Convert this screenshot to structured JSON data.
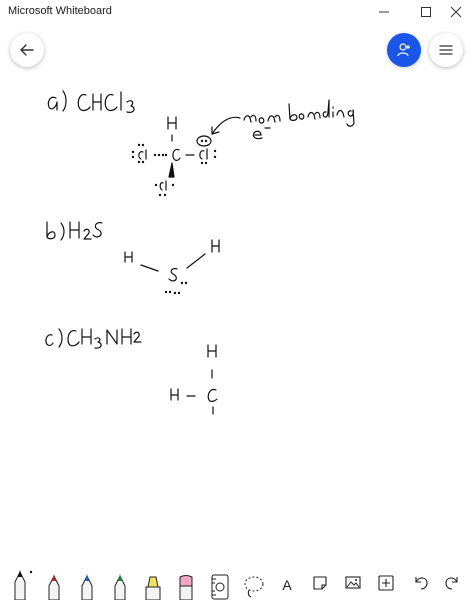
{
  "window": {
    "title": "Microsoft Whiteboard"
  },
  "window_controls": {
    "minimize_icon": "minimize-icon",
    "maximize_icon": "maximize-icon",
    "close_icon": "close-icon"
  },
  "header": {
    "back_icon": "arrow-left-icon",
    "invite_icon": "add-person-icon",
    "menu_icon": "hamburger-menu-icon"
  },
  "colors": {
    "accent_blue": "#1a56e8",
    "ink": "#111111",
    "pen_red": "#d32020",
    "pen_blue": "#1f5fd0",
    "pen_green": "#1c8a3c",
    "highlighter_yellow": "#f2e35a",
    "eraser_pink": "#f2a7c2"
  },
  "board": {
    "handwriting_a": "a)  CHCl₃",
    "handwriting_b": "b)  H₂S",
    "handwriting_c": "c)  CH₃NH₂",
    "annotation": "non bonding e⁻",
    "molecule_a": {
      "top": "H",
      "center": "C",
      "left": ":Cl",
      "right": "Cl:",
      "bottom": "Cl"
    },
    "molecule_b": {
      "left": "H",
      "center": "S",
      "right": "H"
    },
    "molecule_c": {
      "top": "H",
      "left": "H",
      "center": "C"
    }
  },
  "toolbar": {
    "tools": [
      {
        "name": "pen-black",
        "icon": "pen-icon",
        "selected": true
      },
      {
        "name": "pen-red",
        "icon": "pen-icon"
      },
      {
        "name": "pen-blue",
        "icon": "pen-icon"
      },
      {
        "name": "pen-green",
        "icon": "pen-icon"
      },
      {
        "name": "highlighter",
        "icon": "highlighter-icon"
      },
      {
        "name": "eraser",
        "icon": "eraser-icon"
      },
      {
        "name": "ruler",
        "icon": "ruler-icon"
      },
      {
        "name": "lasso",
        "icon": "lasso-icon"
      },
      {
        "name": "text",
        "icon": "text-icon",
        "label": "A"
      },
      {
        "name": "note",
        "icon": "sticky-note-icon"
      },
      {
        "name": "image",
        "icon": "image-icon"
      },
      {
        "name": "insert",
        "icon": "add-icon"
      },
      {
        "name": "undo",
        "icon": "undo-icon"
      },
      {
        "name": "redo",
        "icon": "redo-icon"
      }
    ]
  }
}
